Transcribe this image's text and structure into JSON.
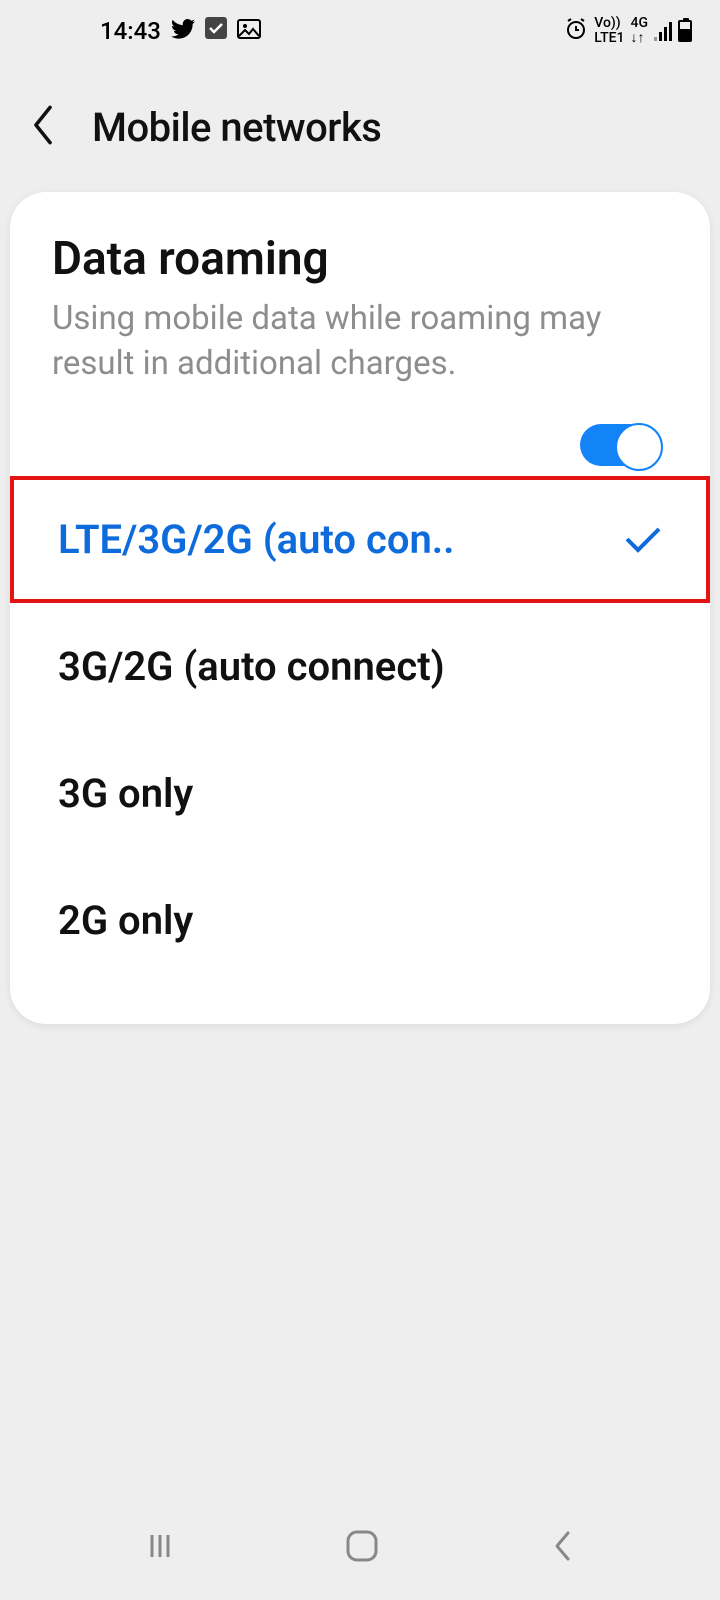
{
  "status": {
    "time": "14:43",
    "icons_left": [
      "twitter",
      "checkbox",
      "image"
    ],
    "icons_right": {
      "alarm": true,
      "net_top": "Vo))",
      "net_bottom": "LTE1",
      "gen": "4G",
      "updown": "↓↑"
    }
  },
  "header": {
    "title": "Mobile networks"
  },
  "roaming": {
    "title": "Data roaming",
    "description": "Using mobile data while roaming may result in additional charges.",
    "enabled": true
  },
  "network_modes": [
    {
      "label": "LTE/3G/2G (auto con..",
      "selected": true
    },
    {
      "label": "3G/2G (auto connect)",
      "selected": false
    },
    {
      "label": "3G only",
      "selected": false
    },
    {
      "label": "2G only",
      "selected": false
    }
  ],
  "colors": {
    "accent": "#0d6bdc",
    "highlight_border": "#e31414",
    "toggle": "#1284f7"
  }
}
